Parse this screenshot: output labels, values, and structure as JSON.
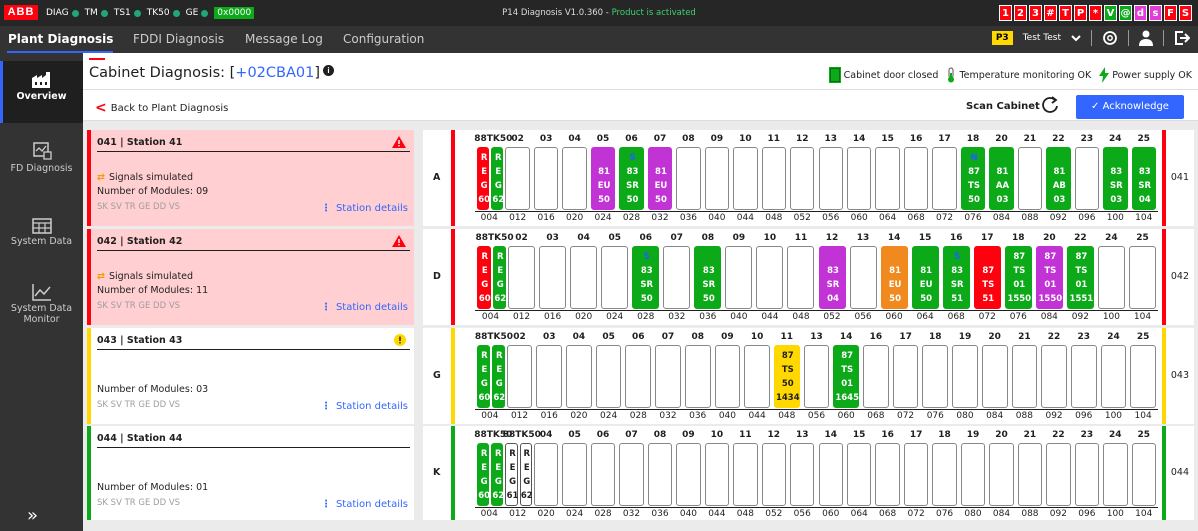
{
  "topbar": {
    "logo": "ABB",
    "indicators": [
      "DIAG",
      "TM",
      "TS1",
      "TK50",
      "GE"
    ],
    "hex_value": "0x0000",
    "app_title": "P14 Diagnosis V1.0.360 - ",
    "app_status": "Product is activated",
    "status_boxes": [
      {
        "t": "1",
        "c": "#ff000f"
      },
      {
        "t": "2",
        "c": "#ff000f"
      },
      {
        "t": "3",
        "c": "#ff000f"
      },
      {
        "t": "#",
        "c": "#ff000f"
      },
      {
        "t": "T",
        "c": "#ff000f"
      },
      {
        "t": "P",
        "c": "#ff000f"
      },
      {
        "t": "*",
        "c": "#ff000f"
      },
      {
        "t": "V",
        "c": "#0ca919"
      },
      {
        "t": "@",
        "c": "#0ca919"
      },
      {
        "t": "d",
        "c": "#e23cd7"
      },
      {
        "t": "s",
        "c": "#e23cd7"
      },
      {
        "t": "F",
        "c": "#ff000f"
      },
      {
        "t": "S",
        "c": "#ff000f"
      }
    ]
  },
  "menu": {
    "tabs": [
      "Plant Diagnosis",
      "FDDI Diagnosis",
      "Message Log",
      "Configuration"
    ],
    "user_level": "P3",
    "user_name": "Test Test"
  },
  "sidebar": {
    "items": [
      "Overview",
      "FD Diagnosis",
      "System Data",
      "System Data Monitor"
    ]
  },
  "header": {
    "title_prefix": "Cabinet Diagnosis: [",
    "cabinet_id": "+02CBA01",
    "title_suffix": "]",
    "door_status": "Cabinet door closed",
    "temp_status": "Temperature monitoring OK",
    "power_status": "Power supply OK",
    "back_label": "Back to Plant Diagnosis",
    "scan_label": "Scan Cabinet",
    "ack_label": "Acknowledge"
  },
  "colors": {
    "red": "#ff000f",
    "green": "#0ca919",
    "magenta": "#c133d4",
    "yellow": "#ffd800",
    "orange": "#f08a1e",
    "blue": "#3366ff"
  },
  "stations": [
    {
      "id": "041",
      "header": "041 | Station 41",
      "state": "alarm",
      "accent": "#ff000f",
      "signals": "Signals simulated",
      "modules": "Number of Modules: 09",
      "sk": "SK SV TR GE DD VS",
      "details": "Station details",
      "rack": "A",
      "rack_num": "041"
    },
    {
      "id": "042",
      "header": "042 | Station 42",
      "state": "alarm",
      "accent": "#ff000f",
      "signals": "Signals simulated",
      "modules": "Number of Modules: 11",
      "sk": "SK SV TR GE DD VS",
      "details": "Station details",
      "rack": "D",
      "rack_num": "042"
    },
    {
      "id": "043",
      "header": "043 | Station 43",
      "state": "warning",
      "accent": "#ffd800",
      "signals": "",
      "modules": "Number of Modules: 03",
      "sk": "SK SV TR GE DD VS",
      "details": "Station details",
      "rack": "G",
      "rack_num": "043"
    },
    {
      "id": "044",
      "header": "044 | Station 44",
      "state": "ok",
      "accent": "#0ca919",
      "signals": "",
      "modules": "Number of Modules: 01",
      "sk": "SK SV TR GE DD VS",
      "details": "Station details",
      "rack": "K",
      "rack_num": "044"
    }
  ],
  "racks": [
    {
      "slot_labels": [
        "88TK50",
        "02",
        "03",
        "04",
        "05",
        "06",
        "07",
        "08",
        "09",
        "10",
        "11",
        "12",
        "13",
        "14",
        "15",
        "16",
        "17",
        "18",
        "20",
        "21",
        "22",
        "23",
        "24",
        "25"
      ],
      "addresses": [
        "004",
        "012",
        "016",
        "020",
        "024",
        "028",
        "032",
        "036",
        "040",
        "044",
        "048",
        "052",
        "056",
        "060",
        "064",
        "068",
        "072",
        "076",
        "084",
        "088",
        "092",
        "096",
        "100",
        "104"
      ],
      "modules": [
        {
          "slot": 0,
          "color": "#ff000f",
          "lines": [
            "R",
            "E",
            "G",
            "60"
          ]
        },
        {
          "slot": 0.5,
          "color": "#0ca919",
          "lines": [
            "R",
            "E",
            "G",
            "62"
          ]
        },
        {
          "slot": 4,
          "color": "#c133d4",
          "lines": [
            "",
            "81",
            "EU",
            "50"
          ]
        },
        {
          "slot": 5,
          "color": "#0ca919",
          "lines": [
            "S",
            "83",
            "SR",
            "50"
          ]
        },
        {
          "slot": 6,
          "color": "#c133d4",
          "lines": [
            "",
            "81",
            "EU",
            "50"
          ]
        },
        {
          "slot": 17,
          "color": "#0ca919",
          "lines": [
            "N",
            "87",
            "TS",
            "50"
          ]
        },
        {
          "slot": 18,
          "color": "#0ca919",
          "lines": [
            "",
            "81",
            "AA",
            "03"
          ]
        },
        {
          "slot": 20,
          "color": "#0ca919",
          "lines": [
            "",
            "81",
            "AB",
            "03"
          ]
        },
        {
          "slot": 22,
          "color": "#0ca919",
          "lines": [
            "",
            "83",
            "SR",
            "03"
          ]
        },
        {
          "slot": 23,
          "color": "#0ca919",
          "lines": [
            "",
            "83",
            "SR",
            "04"
          ]
        }
      ]
    },
    {
      "slot_labels": [
        "88TK50",
        "02",
        "03",
        "04",
        "05",
        "06",
        "07",
        "08",
        "09",
        "10",
        "11",
        "12",
        "13",
        "14",
        "15",
        "16",
        "17",
        "18",
        "20",
        "22",
        "24",
        "25"
      ],
      "addresses": [
        "004",
        "012",
        "016",
        "020",
        "024",
        "028",
        "032",
        "036",
        "040",
        "044",
        "048",
        "052",
        "056",
        "060",
        "064",
        "068",
        "072",
        "076",
        "084",
        "092",
        "100",
        "104"
      ],
      "modules": [
        {
          "slot": 0,
          "color": "#ff000f",
          "lines": [
            "R",
            "E",
            "G",
            "60"
          ]
        },
        {
          "slot": 0.5,
          "color": "#0ca919",
          "lines": [
            "R",
            "E",
            "G",
            "62"
          ]
        },
        {
          "slot": 5,
          "color": "#0ca919",
          "lines": [
            "S",
            "83",
            "SR",
            "50"
          ]
        },
        {
          "slot": 7,
          "color": "#0ca919",
          "lines": [
            "",
            "83",
            "SR",
            "50"
          ]
        },
        {
          "slot": 11,
          "color": "#c133d4",
          "lines": [
            "",
            "83",
            "SR",
            "04"
          ]
        },
        {
          "slot": 13,
          "color": "#f08a1e",
          "lines": [
            "",
            "81",
            "EU",
            "50"
          ]
        },
        {
          "slot": 14,
          "color": "#0ca919",
          "lines": [
            "",
            "81",
            "EU",
            "50"
          ]
        },
        {
          "slot": 15,
          "color": "#0ca919",
          "lines": [
            "S",
            "83",
            "SR",
            "51"
          ]
        },
        {
          "slot": 16,
          "color": "#ff000f",
          "lines": [
            "",
            "87",
            "TS",
            "51"
          ]
        },
        {
          "slot": 17,
          "color": "#0ca919",
          "lines": [
            "87",
            "TS",
            "01",
            "1550"
          ]
        },
        {
          "slot": 18,
          "color": "#c133d4",
          "lines": [
            "87",
            "TS",
            "01",
            "1550"
          ]
        },
        {
          "slot": 19,
          "color": "#0ca919",
          "lines": [
            "87",
            "TS",
            "01",
            "1551"
          ]
        }
      ]
    },
    {
      "slot_labels": [
        "88TK50",
        "02",
        "03",
        "04",
        "05",
        "06",
        "07",
        "08",
        "09",
        "10",
        "11",
        "13",
        "14",
        "16",
        "17",
        "18",
        "19",
        "20",
        "21",
        "22",
        "23",
        "24",
        "25"
      ],
      "addresses": [
        "004",
        "012",
        "016",
        "020",
        "024",
        "028",
        "032",
        "036",
        "040",
        "044",
        "048",
        "056",
        "060",
        "068",
        "072",
        "076",
        "080",
        "084",
        "088",
        "092",
        "096",
        "100",
        "104"
      ],
      "modules": [
        {
          "slot": 0,
          "color": "#0ca919",
          "lines": [
            "R",
            "E",
            "G",
            "60"
          ]
        },
        {
          "slot": 0.5,
          "color": "#0ca919",
          "lines": [
            "R",
            "E",
            "G",
            "62"
          ]
        },
        {
          "slot": 10,
          "color": "#ffd800",
          "lines": [
            "87",
            "TS",
            "50",
            "1434"
          ]
        },
        {
          "slot": 12,
          "color": "#0ca919",
          "lines": [
            "87",
            "TS",
            "01",
            "1645"
          ]
        }
      ]
    },
    {
      "slot_labels": [
        "88TK50",
        "88TK50",
        "04",
        "05",
        "06",
        "07",
        "08",
        "09",
        "10",
        "11",
        "12",
        "13",
        "14",
        "15",
        "16",
        "17",
        "18",
        "19",
        "20",
        "21",
        "22",
        "23",
        "24",
        "25"
      ],
      "addresses": [
        "004",
        "012",
        "020",
        "024",
        "028",
        "032",
        "036",
        "040",
        "044",
        "048",
        "052",
        "056",
        "060",
        "064",
        "068",
        "072",
        "076",
        "080",
        "084",
        "088",
        "092",
        "096",
        "100",
        "104"
      ],
      "modules": [
        {
          "slot": 0,
          "color": "#0ca919",
          "lines": [
            "R",
            "E",
            "G",
            "60"
          ]
        },
        {
          "slot": 0.5,
          "color": "#0ca919",
          "lines": [
            "R",
            "E",
            "G",
            "62"
          ]
        },
        {
          "slot": 1,
          "color": "#ffffff",
          "lines": [
            "R",
            "E",
            "G",
            "61"
          ]
        },
        {
          "slot": 1.5,
          "color": "#ffffff",
          "lines": [
            "R",
            "E",
            "G",
            "62"
          ]
        }
      ]
    }
  ]
}
